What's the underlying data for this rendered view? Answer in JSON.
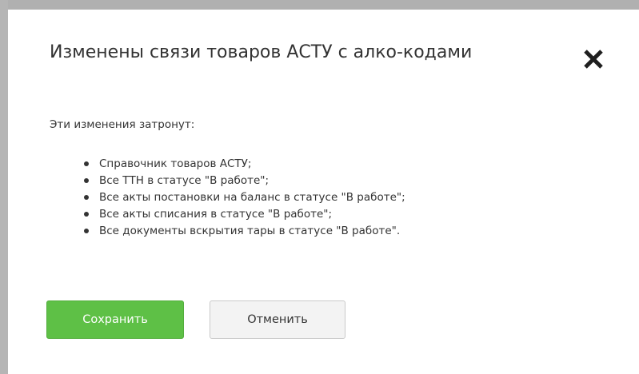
{
  "dialog": {
    "title": "Изменены связи товаров АСТУ с алко-кодами",
    "intro": "Эти изменения затронут:",
    "items": [
      "Справочник товаров АСТУ;",
      "Все ТТН в статусе \"В работе\";",
      "Все акты постановки на баланс в статусе \"В работе\";",
      "Все акты списания в статусе \"В работе\";",
      "Все документы вскрытия тары в статусе \"В работе\"."
    ],
    "close_icon": "close-icon",
    "save_label": "Сохранить",
    "cancel_label": "Отменить"
  },
  "colors": {
    "save_button": "#5ec046",
    "cancel_button": "#f3f3f3",
    "text": "#333333"
  }
}
